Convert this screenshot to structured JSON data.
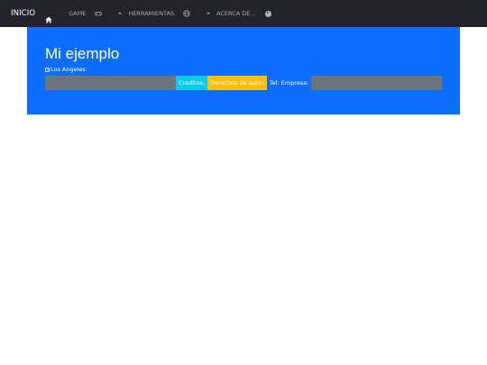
{
  "navbar": {
    "brand": "INICIO",
    "items": [
      {
        "label": "GAME",
        "icon": "gamepad-icon"
      },
      {
        "label": "HERRAMIENTAS",
        "icon": "globe-icon"
      },
      {
        "label": "ACERCA DE...",
        "icon": "play-circle-icon"
      }
    ]
  },
  "hero": {
    "title": "Mi ejemplo",
    "image_alt": "Los Angeles"
  },
  "footer_bar": {
    "credits_label": "Creditos:",
    "rights_label": "Derechos de autor",
    "tel_label": "Tel: Empresa:"
  },
  "colors": {
    "navbar_bg": "#212529",
    "hero_bg": "#0d6efd",
    "gray": "#6c757d",
    "info": "#0dcaf0",
    "warning": "#ffc107"
  }
}
